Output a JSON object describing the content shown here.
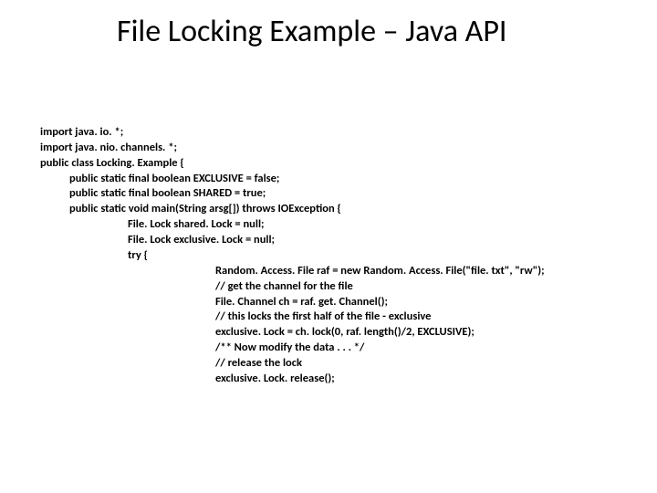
{
  "title": "File Locking Example – Java API",
  "code": {
    "l1": "import java. io. *;",
    "l2": "import java. nio. channels. *;",
    "l3": "public class Locking. Example {",
    "l4": "public static final boolean EXCLUSIVE = false;",
    "l5": "public static final boolean SHARED = true;",
    "l6": "public static void main(String arsg[]) throws IOException {",
    "l7": "File. Lock shared. Lock = null;",
    "l8": "File. Lock exclusive. Lock = null;",
    "l9": "try {",
    "l10": "Random. Access. File raf = new Random. Access. File(\"file. txt\", \"rw\");",
    "l11": "// get the channel for the file",
    "l12": "File. Channel ch = raf. get. Channel();",
    "l13": "// this locks the first half of the file - exclusive",
    "l14": "exclusive. Lock = ch. lock(0, raf. length()/2, EXCLUSIVE);",
    "l15": "/** Now modify the data . . . */",
    "l16": "// release the lock",
    "l17": "exclusive. Lock. release();"
  }
}
